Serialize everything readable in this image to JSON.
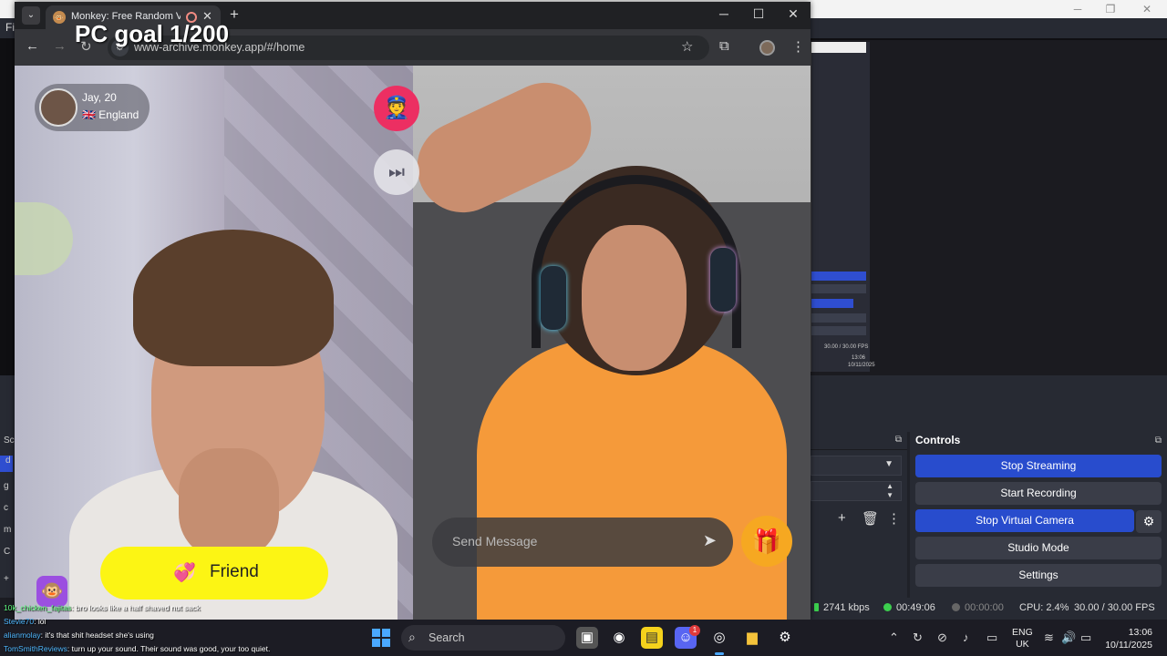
{
  "obs": {
    "menu_file": "Fil",
    "controls": {
      "title": "Controls",
      "stop_streaming": "Stop Streaming",
      "start_recording": "Start Recording",
      "stop_virtual_camera": "Stop Virtual Camera",
      "studio_mode": "Studio Mode",
      "settings": "Settings"
    },
    "status": {
      "bitrate": "2741 kbps",
      "stream_time": "00:49:06",
      "record_time": "00:00:00",
      "cpu": "CPU: 2.4%",
      "fps": "30.00 / 30.00 FPS"
    },
    "mini_preview": {
      "fps_text": "30.00 / 30.00 FPS",
      "time": "13:06",
      "date": "10/11/2025"
    },
    "colors": {
      "accent": "#284ccd",
      "live_green": "#3ccf4e"
    }
  },
  "browser": {
    "tab_title": "Monkey: Free Random Vide",
    "url": "www-archive.monkey.app/#/home",
    "icons": [
      "back-icon",
      "forward-icon",
      "reload-icon",
      "star-icon",
      "extensions-icon",
      "menu-icon"
    ]
  },
  "overlay": {
    "goal_text": "PC goal 1/200"
  },
  "monkey": {
    "user_name": "Jay, 20",
    "user_country": "🇬🇧 England",
    "police_icon": "👮",
    "skip_icon": "⏭",
    "friend_label": "Friend",
    "friend_icon": "💞",
    "message_placeholder": "Send Message",
    "send_icon": "➤",
    "gift_icon": "🎁",
    "colors": {
      "friend_yellow": "#fcf514",
      "police_pink": "#ec2f62",
      "gift_orange": "#f6a821"
    }
  },
  "chat": [
    {
      "user": "10k_chicken_fajitas",
      "text": ": bro looks like a half shaved nut sack"
    },
    {
      "user": "Stevie70",
      "text": ": lol"
    },
    {
      "user": "alianmolay",
      "text": ": it's that shit headset she's using"
    },
    {
      "user": "TomSmithReviews",
      "text": ": turn up your sound. Their sound was good, your too quiet."
    }
  ],
  "taskbar": {
    "search_label": "Search",
    "discord_badge": "1",
    "lang_top": "ENG",
    "lang_bottom": "UK",
    "time": "13:06",
    "date": "10/11/2025"
  }
}
